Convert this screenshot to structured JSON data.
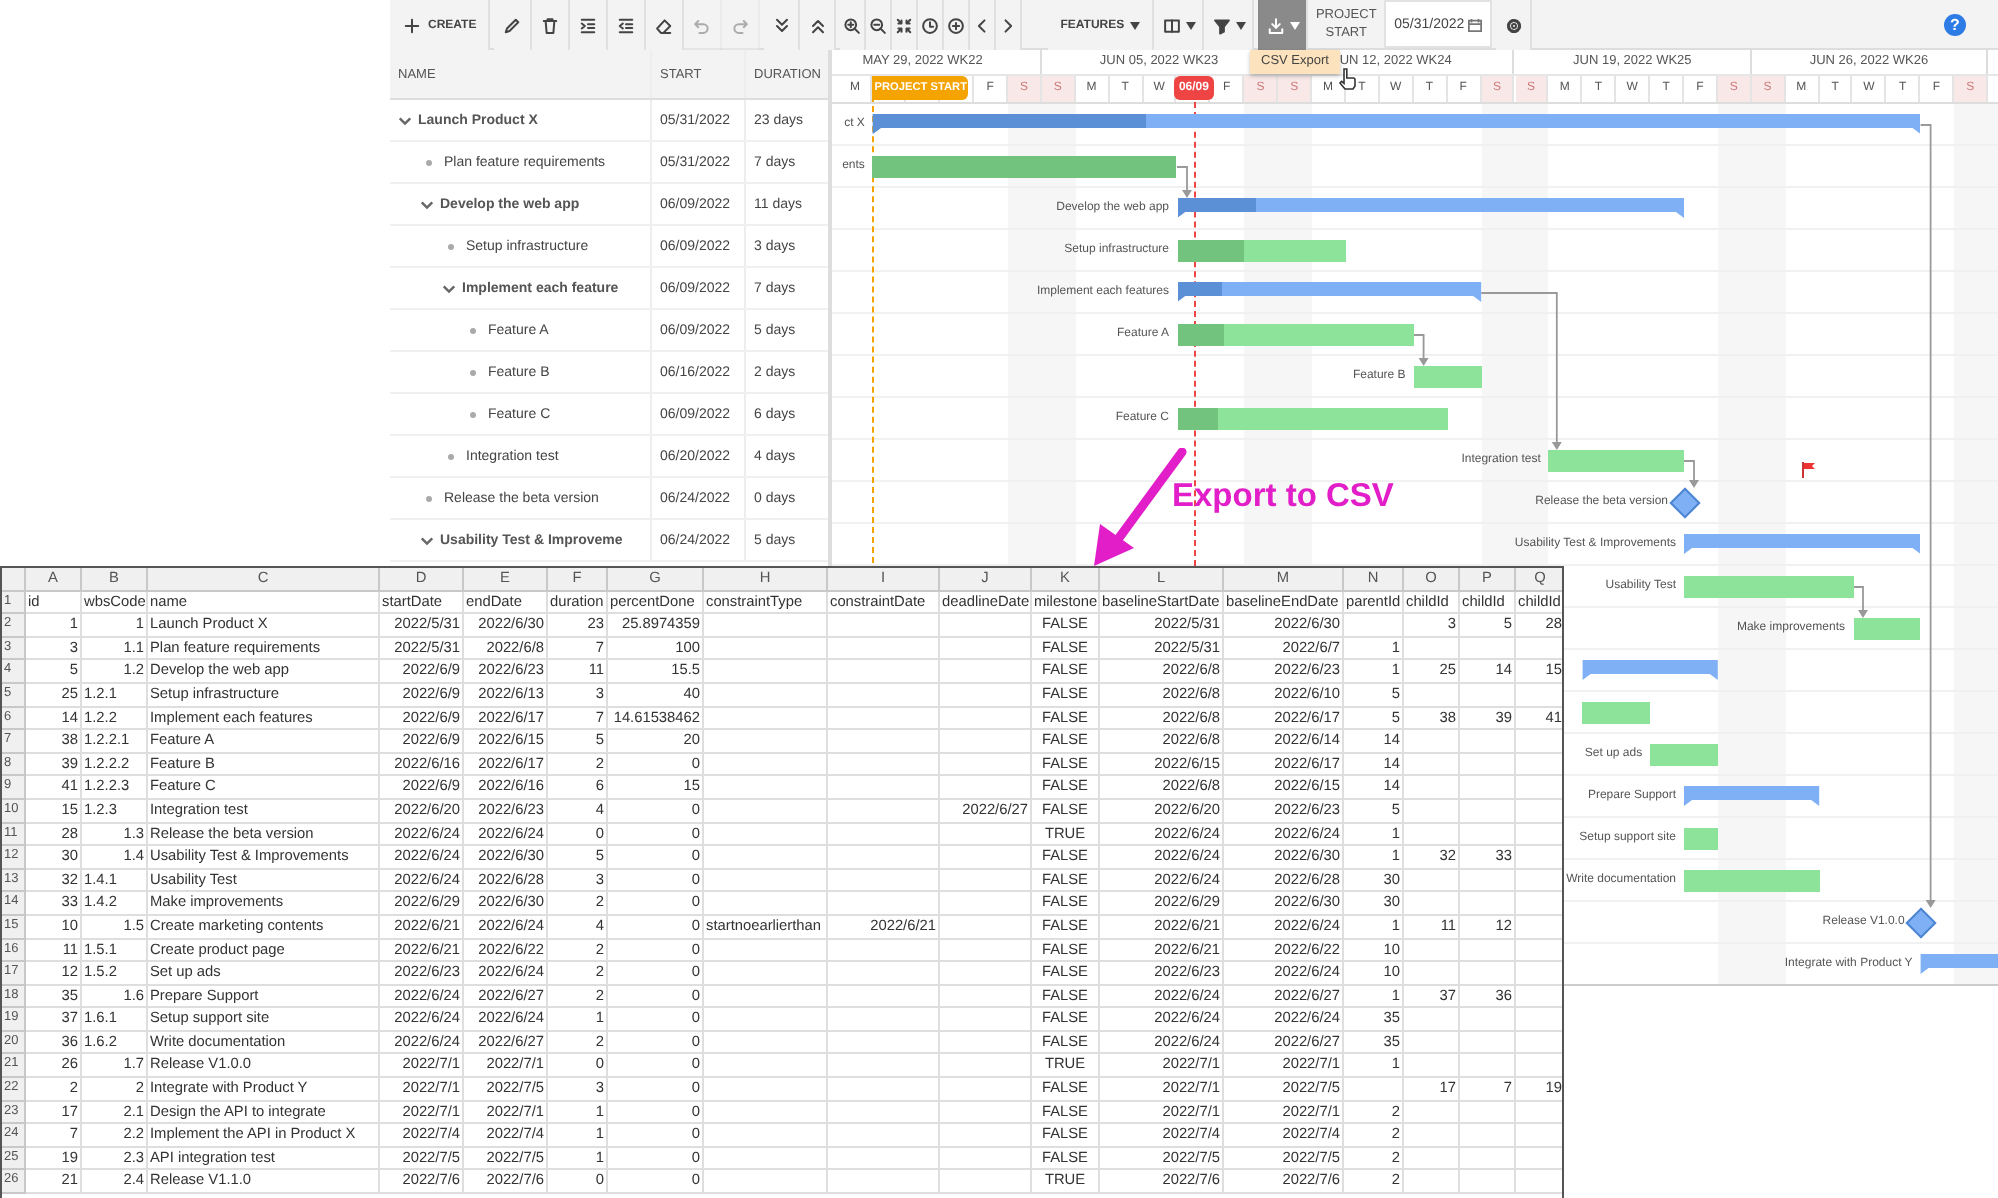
{
  "toolbar": {
    "groups": [
      {
        "items": [
          {
            "kind": "create",
            "label": "CREATE",
            "disabled": false,
            "pressed": false
          }
        ]
      },
      {
        "items": [
          {
            "kind": "edit",
            "disabled": false,
            "pressed": false
          },
          {
            "kind": "delete",
            "disabled": false,
            "pressed": false
          },
          {
            "kind": "indent",
            "disabled": false,
            "pressed": false
          },
          {
            "kind": "outdent",
            "disabled": false,
            "pressed": false
          },
          {
            "kind": "erase",
            "disabled": false,
            "pressed": false
          },
          {
            "kind": "undo",
            "disabled": true,
            "pressed": false
          },
          {
            "kind": "redo",
            "disabled": true,
            "pressed": false
          }
        ]
      },
      {
        "items": [
          {
            "kind": "expand-all",
            "disabled": false,
            "pressed": false
          },
          {
            "kind": "collapse-all",
            "disabled": false,
            "pressed": false
          }
        ]
      },
      {
        "items": [
          {
            "kind": "zoom-in",
            "disabled": false,
            "pressed": false
          },
          {
            "kind": "zoom-out",
            "disabled": false,
            "pressed": false
          },
          {
            "kind": "fit",
            "disabled": false,
            "pressed": false
          },
          {
            "kind": "clock",
            "disabled": false,
            "pressed": false
          },
          {
            "kind": "add",
            "disabled": false,
            "pressed": false
          },
          {
            "kind": "previous",
            "disabled": false,
            "pressed": false
          },
          {
            "kind": "next",
            "disabled": false,
            "pressed": false
          }
        ]
      },
      {
        "items": [
          {
            "kind": "features",
            "label": "FEATURES",
            "disabled": false,
            "pressed": false
          },
          {
            "kind": "columns",
            "disabled": false,
            "pressed": false
          },
          {
            "kind": "filter",
            "disabled": false,
            "pressed": false
          }
        ]
      },
      {
        "items": [
          {
            "kind": "export",
            "disabled": false,
            "pressed": true
          }
        ]
      }
    ],
    "project_start_label": "PROJECT START",
    "project_start_value": "05/31/2022",
    "help": "?"
  },
  "export_menu": {
    "items": [
      "CSV Export"
    ]
  },
  "timeline": {
    "weeks": [
      "MAY 29, 2022 WK22",
      "JUN 05, 2022 WK23",
      "UN 12, 2022 WK24",
      "JUN 19, 2022 WK25",
      "JUN 26, 2022 WK26"
    ],
    "days": [
      {
        "letter": "M",
        "weekend": false
      },
      {
        "weekend": false
      },
      {
        "weekend": false
      },
      {
        "weekend": false
      },
      {
        "letter": "F",
        "weekend": false
      },
      {
        "letter": "S",
        "weekend": true
      },
      {
        "letter": "S",
        "weekend": true
      },
      {
        "letter": "M",
        "weekend": false
      },
      {
        "letter": "T",
        "weekend": false
      },
      {
        "letter": "W",
        "weekend": false
      },
      {
        "weekend": false
      },
      {
        "letter": "F",
        "weekend": false
      },
      {
        "letter": "S",
        "weekend": true
      },
      {
        "letter": "S",
        "weekend": true
      },
      {
        "letter": "M",
        "weekend": false
      },
      {
        "letter": "T",
        "weekend": false
      },
      {
        "letter": "W",
        "weekend": false
      },
      {
        "letter": "T",
        "weekend": false
      },
      {
        "letter": "F",
        "weekend": false
      },
      {
        "letter": "S",
        "weekend": true
      },
      {
        "letter": "S",
        "weekend": true
      },
      {
        "letter": "M",
        "weekend": false
      },
      {
        "letter": "T",
        "weekend": false
      },
      {
        "letter": "W",
        "weekend": false
      },
      {
        "letter": "T",
        "weekend": false
      },
      {
        "letter": "F",
        "weekend": false
      },
      {
        "letter": "S",
        "weekend": true
      },
      {
        "letter": "S",
        "weekend": true
      },
      {
        "letter": "M",
        "weekend": false
      },
      {
        "letter": "T",
        "weekend": false
      },
      {
        "letter": "W",
        "weekend": false
      },
      {
        "letter": "T",
        "weekend": false
      },
      {
        "letter": "F",
        "weekend": false
      },
      {
        "letter": "S",
        "weekend": true
      }
    ],
    "project_start_marker": "PROJECT START",
    "today_marker": "06/09"
  },
  "grid": {
    "columns": [
      "NAME",
      "START",
      "DURATION"
    ],
    "rows": [
      {
        "name": "Launch Product X",
        "start": "05/31/2022",
        "duration": "23 days",
        "kind": "summary",
        "expanded": true,
        "children": [
          {
            "name": "Plan feature requirements",
            "start": "05/31/2022",
            "duration": "7 days",
            "kind": "task"
          },
          {
            "name": "Develop the web app",
            "start": "06/09/2022",
            "duration": "11 days",
            "kind": "summary",
            "expanded": true,
            "children": [
              {
                "name": "Setup infrastructure",
                "start": "06/09/2022",
                "duration": "3 days",
                "kind": "task"
              },
              {
                "name": "Implement each feature",
                "start": "06/09/2022",
                "duration": "7 days",
                "kind": "summary",
                "expanded": true,
                "children": [
                  {
                    "name": "Feature A",
                    "start": "06/09/2022",
                    "duration": "5 days",
                    "kind": "task"
                  },
                  {
                    "name": "Feature B",
                    "start": "06/16/2022",
                    "duration": "2 days",
                    "kind": "task"
                  },
                  {
                    "name": "Feature C",
                    "start": "06/09/2022",
                    "duration": "6 days",
                    "kind": "task"
                  }
                ]
              },
              {
                "name": "Integration test",
                "start": "06/20/2022",
                "duration": "4 days",
                "kind": "task"
              }
            ]
          },
          {
            "name": "Release the beta version",
            "start": "06/24/2022",
            "duration": "0 days",
            "kind": "task"
          },
          {
            "name": "Usability Test & Improveme",
            "start": "06/24/2022",
            "duration": "5 days",
            "kind": "summary",
            "expanded": true
          }
        ]
      }
    ]
  },
  "chart": {
    "bars": [
      {
        "kind": "summary",
        "label": "ct X",
        "level": 0.26
      },
      {
        "kind": "task",
        "label": "ents",
        "level": 1
      },
      {
        "kind": "summary",
        "label": "Develop the web app",
        "level": 0.155
      },
      {
        "kind": "task",
        "label": "Setup infrastructure",
        "level": 0.4
      },
      {
        "kind": "summary",
        "label": "Implement each features",
        "level": 0.146
      },
      {
        "kind": "task",
        "label": "Feature A",
        "level": 0.2
      },
      {
        "kind": "task",
        "label": "Feature B",
        "level": 0
      },
      {
        "kind": "task",
        "label": "Feature C",
        "level": 0.15
      },
      {
        "kind": "task",
        "label": "Integration test",
        "level": 0
      },
      {
        "kind": "milestone",
        "label": "Release the beta version"
      },
      {
        "kind": "summary",
        "label": "Usability Test & Improvements",
        "level": 0
      },
      {
        "kind": "task",
        "label": "Usability Test",
        "level": 0
      },
      {
        "kind": "task",
        "label": "Make improvements",
        "level": 0
      },
      {
        "kind": "summary",
        "level": 0
      },
      {
        "kind": "task",
        "level": 0
      },
      {
        "kind": "task",
        "label": "Set up ads",
        "level": 0
      },
      {
        "kind": "summary",
        "label": "Prepare Support",
        "level": 0
      },
      {
        "kind": "task",
        "label": "Setup support site",
        "level": 0
      },
      {
        "kind": "task",
        "label": "Write documentation",
        "level": 0
      },
      {
        "kind": "milestone",
        "label": "Release V1.0.0"
      },
      {
        "kind": "summary",
        "label": "Integrate with Product Y",
        "level": 0
      }
    ]
  },
  "annotation": {
    "text": "Export to CSV"
  },
  "spreadsheet": {
    "columns": [
      "A",
      "B",
      "C",
      "D",
      "E",
      "F",
      "G",
      "H",
      "I",
      "J",
      "K",
      "L",
      "M",
      "N",
      "O",
      "P",
      "Q"
    ],
    "rows": [
      {
        "number": "1",
        "kind": "header",
        "cells": [
          "id",
          "wbsCode",
          "name",
          "startDate",
          "endDate",
          "duration",
          "percentDone",
          "constraintType",
          "constraintDate",
          "deadlineDate",
          "milestone",
          "baselineStartDate",
          "baselineEndDate",
          "parentId",
          "childId",
          "childId",
          "childId"
        ]
      },
      {
        "number": "2",
        "kind": "data",
        "wbs_text": false,
        "cells": [
          "1",
          "1",
          "Launch Product X",
          "2022/5/31",
          "2022/6/30",
          "23",
          "25.8974359",
          null,
          null,
          null,
          "FALSE",
          "2022/5/31",
          "2022/6/30",
          null,
          "3",
          "5",
          "28"
        ]
      },
      {
        "number": "3",
        "kind": "data",
        "wbs_text": false,
        "cells": [
          "3",
          "1.1",
          "Plan feature requirements",
          "2022/5/31",
          "2022/6/8",
          "7",
          "100",
          null,
          null,
          null,
          "FALSE",
          "2022/5/31",
          "2022/6/7",
          "1"
        ]
      },
      {
        "number": "4",
        "kind": "data",
        "wbs_text": false,
        "cells": [
          "5",
          "1.2",
          "Develop the web app",
          "2022/6/9",
          "2022/6/23",
          "11",
          "15.5",
          null,
          null,
          null,
          "FALSE",
          "2022/6/8",
          "2022/6/23",
          "1",
          "25",
          "14",
          "15"
        ]
      },
      {
        "number": "5",
        "kind": "data",
        "wbs_text": true,
        "cells": [
          "25",
          "1.2.1",
          "Setup infrastructure",
          "2022/6/9",
          "2022/6/13",
          "3",
          "40",
          null,
          null,
          null,
          "FALSE",
          "2022/6/8",
          "2022/6/10",
          "5"
        ]
      },
      {
        "number": "6",
        "kind": "data",
        "wbs_text": true,
        "cells": [
          "14",
          "1.2.2",
          "Implement each features",
          "2022/6/9",
          "2022/6/17",
          "7",
          "14.61538462",
          null,
          null,
          null,
          "FALSE",
          "2022/6/8",
          "2022/6/17",
          "5",
          "38",
          "39",
          "41"
        ]
      },
      {
        "number": "7",
        "kind": "data",
        "wbs_text": true,
        "cells": [
          "38",
          "1.2.2.1",
          "Feature A",
          "2022/6/9",
          "2022/6/15",
          "5",
          "20",
          null,
          null,
          null,
          "FALSE",
          "2022/6/8",
          "2022/6/14",
          "14"
        ]
      },
      {
        "number": "8",
        "kind": "data",
        "wbs_text": true,
        "cells": [
          "39",
          "1.2.2.2",
          "Feature B",
          "2022/6/16",
          "2022/6/17",
          "2",
          "0",
          null,
          null,
          null,
          "FALSE",
          "2022/6/15",
          "2022/6/17",
          "14"
        ]
      },
      {
        "number": "9",
        "kind": "data",
        "wbs_text": true,
        "cells": [
          "41",
          "1.2.2.3",
          "Feature C",
          "2022/6/9",
          "2022/6/16",
          "6",
          "15",
          null,
          null,
          null,
          "FALSE",
          "2022/6/8",
          "2022/6/15",
          "14"
        ]
      },
      {
        "number": "10",
        "kind": "data",
        "wbs_text": true,
        "cells": [
          "15",
          "1.2.3",
          "Integration test",
          "2022/6/20",
          "2022/6/23",
          "4",
          "0",
          null,
          null,
          "2022/6/27",
          "FALSE",
          "2022/6/20",
          "2022/6/23",
          "5"
        ]
      },
      {
        "number": "11",
        "kind": "data",
        "wbs_text": false,
        "cells": [
          "28",
          "1.3",
          "Release the beta version",
          "2022/6/24",
          "2022/6/24",
          "0",
          "0",
          null,
          null,
          null,
          "TRUE",
          "2022/6/24",
          "2022/6/24",
          "1"
        ]
      },
      {
        "number": "12",
        "kind": "data",
        "wbs_text": false,
        "cells": [
          "30",
          "1.4",
          "Usability Test & Improvements",
          "2022/6/24",
          "2022/6/30",
          "5",
          "0",
          null,
          null,
          null,
          "FALSE",
          "2022/6/24",
          "2022/6/30",
          "1",
          "32",
          "33"
        ]
      },
      {
        "number": "13",
        "kind": "data",
        "wbs_text": true,
        "cells": [
          "32",
          "1.4.1",
          "Usability Test",
          "2022/6/24",
          "2022/6/28",
          "3",
          "0",
          null,
          null,
          null,
          "FALSE",
          "2022/6/24",
          "2022/6/28",
          "30"
        ]
      },
      {
        "number": "14",
        "kind": "data",
        "wbs_text": true,
        "cells": [
          "33",
          "1.4.2",
          "Make improvements",
          "2022/6/29",
          "2022/6/30",
          "2",
          "0",
          null,
          null,
          null,
          "FALSE",
          "2022/6/29",
          "2022/6/30",
          "30"
        ]
      },
      {
        "number": "15",
        "kind": "data",
        "wbs_text": false,
        "cells": [
          "10",
          "1.5",
          "Create marketing contents",
          "2022/6/21",
          "2022/6/24",
          "4",
          "0",
          "startnoearlierthan",
          "2022/6/21",
          null,
          "FALSE",
          "2022/6/21",
          "2022/6/24",
          "1",
          "11",
          "12"
        ]
      },
      {
        "number": "16",
        "kind": "data",
        "wbs_text": true,
        "cells": [
          "11",
          "1.5.1",
          "Create product page",
          "2022/6/21",
          "2022/6/22",
          "2",
          "0",
          null,
          null,
          null,
          "FALSE",
          "2022/6/21",
          "2022/6/22",
          "10"
        ]
      },
      {
        "number": "17",
        "kind": "data",
        "wbs_text": true,
        "cells": [
          "12",
          "1.5.2",
          "Set up ads",
          "2022/6/23",
          "2022/6/24",
          "2",
          "0",
          null,
          null,
          null,
          "FALSE",
          "2022/6/23",
          "2022/6/24",
          "10"
        ]
      },
      {
        "number": "18",
        "kind": "data",
        "wbs_text": false,
        "cells": [
          "35",
          "1.6",
          "Prepare Support",
          "2022/6/24",
          "2022/6/27",
          "2",
          "0",
          null,
          null,
          null,
          "FALSE",
          "2022/6/24",
          "2022/6/27",
          "1",
          "37",
          "36"
        ]
      },
      {
        "number": "19",
        "kind": "data",
        "wbs_text": true,
        "cells": [
          "37",
          "1.6.1",
          "Setup support site",
          "2022/6/24",
          "2022/6/24",
          "1",
          "0",
          null,
          null,
          null,
          "FALSE",
          "2022/6/24",
          "2022/6/24",
          "35"
        ]
      },
      {
        "number": "20",
        "kind": "data",
        "wbs_text": true,
        "cells": [
          "36",
          "1.6.2",
          "Write documentation",
          "2022/6/24",
          "2022/6/27",
          "2",
          "0",
          null,
          null,
          null,
          "FALSE",
          "2022/6/24",
          "2022/6/27",
          "35"
        ]
      },
      {
        "number": "21",
        "kind": "data",
        "wbs_text": false,
        "cells": [
          "26",
          "1.7",
          "Release V1.0.0",
          "2022/7/1",
          "2022/7/1",
          "0",
          "0",
          null,
          null,
          null,
          "TRUE",
          "2022/7/1",
          "2022/7/1",
          "1"
        ]
      },
      {
        "number": "22",
        "kind": "data",
        "wbs_text": false,
        "cells": [
          "2",
          "2",
          "Integrate with Product Y",
          "2022/7/1",
          "2022/7/5",
          "3",
          "0",
          null,
          null,
          null,
          "FALSE",
          "2022/7/1",
          "2022/7/5",
          null,
          "17",
          "7",
          "19"
        ]
      },
      {
        "number": "23",
        "kind": "data",
        "wbs_text": false,
        "cells": [
          "17",
          "2.1",
          "Design the API to integrate",
          "2022/7/1",
          "2022/7/1",
          "1",
          "0",
          null,
          null,
          null,
          "FALSE",
          "2022/7/1",
          "2022/7/1",
          "2"
        ]
      },
      {
        "number": "24",
        "kind": "data",
        "wbs_text": false,
        "cells": [
          "7",
          "2.2",
          "Implement the API in Product X",
          "2022/7/4",
          "2022/7/4",
          "1",
          "0",
          null,
          null,
          null,
          "FALSE",
          "2022/7/4",
          "2022/7/4",
          "2"
        ]
      },
      {
        "number": "25",
        "kind": "data",
        "wbs_text": false,
        "cells": [
          "19",
          "2.3",
          "API integration test",
          "2022/7/5",
          "2022/7/5",
          "1",
          "0",
          null,
          null,
          null,
          "FALSE",
          "2022/7/5",
          "2022/7/5",
          "2"
        ]
      },
      {
        "number": "26",
        "kind": "data",
        "wbs_text": false,
        "cells": [
          "21",
          "2.4",
          "Release V1.1.0",
          "2022/7/6",
          "2022/7/6",
          "0",
          "0",
          null,
          null,
          null,
          "TRUE",
          "2022/7/6",
          "2022/7/6",
          "2"
        ]
      }
    ]
  }
}
